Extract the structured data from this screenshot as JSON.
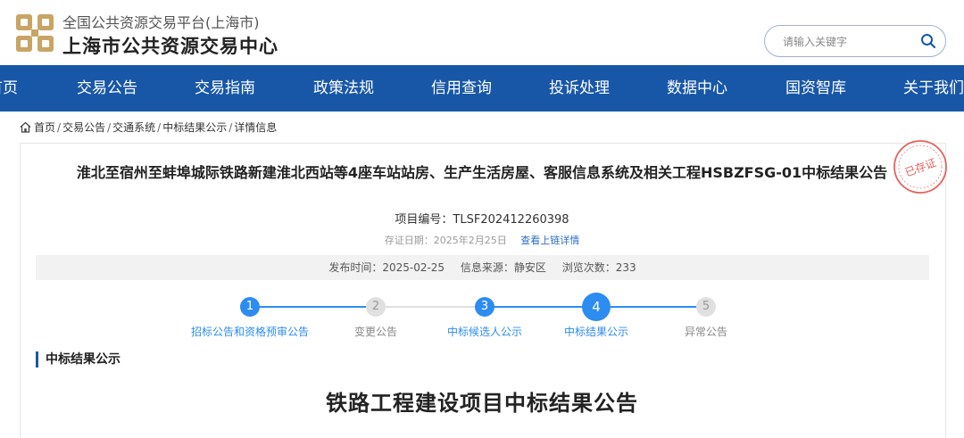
{
  "header": {
    "site_subtitle": "全国公共资源交易平台(上海市)",
    "site_title": "上海市公共资源交易中心",
    "logo_icon": "logo-icon",
    "brand_color": "#c8a465"
  },
  "search": {
    "placeholder": "请输入关键字",
    "icon": "search-icon"
  },
  "nav": {
    "color": "#1857a8",
    "items": [
      {
        "label": "首页"
      },
      {
        "label": "交易公告"
      },
      {
        "label": "交易指南"
      },
      {
        "label": "政策法规"
      },
      {
        "label": "信用查询"
      },
      {
        "label": "投诉处理"
      },
      {
        "label": "数据中心"
      },
      {
        "label": "国资智库"
      },
      {
        "label": "关于我们"
      }
    ]
  },
  "breadcrumb": {
    "icon": "home-icon",
    "items": [
      "首页",
      "交易公告",
      "交通系统",
      "中标结果公示",
      "详情信息"
    ]
  },
  "article": {
    "title": "淮北至宿州至蚌埠城际铁路新建淮北西站等4座车站站房、生产生活房屋、客服信息系统及相关工程HSBZFSG-01中标结果公告",
    "project_no": "项目编号：TLSF202412260398",
    "cert_date": "存证日期：2025年2月25日",
    "cert_link": "查看上链详情",
    "stamp_text": "已存证",
    "stamp_color": "#e0463f",
    "info": {
      "publish_time": "发布时间：2025-02-25",
      "source": "信息来源：静安区",
      "views": "浏览次数：233"
    }
  },
  "steps": {
    "active_color": "#2d8cf0",
    "inactive_color": "#e0e0e0",
    "current": 4,
    "items": [
      {
        "num": "1",
        "label": "招标公告和资格预审公告",
        "done": true
      },
      {
        "num": "2",
        "label": "变更公告",
        "done": false
      },
      {
        "num": "3",
        "label": "中标候选人公示",
        "done": true
      },
      {
        "num": "4",
        "label": "中标结果公示",
        "done": true
      },
      {
        "num": "5",
        "label": "异常公告",
        "done": false
      }
    ]
  },
  "section": {
    "heading": "中标结果公示",
    "doc_title": "铁路工程建设项目中标结果公告"
  }
}
